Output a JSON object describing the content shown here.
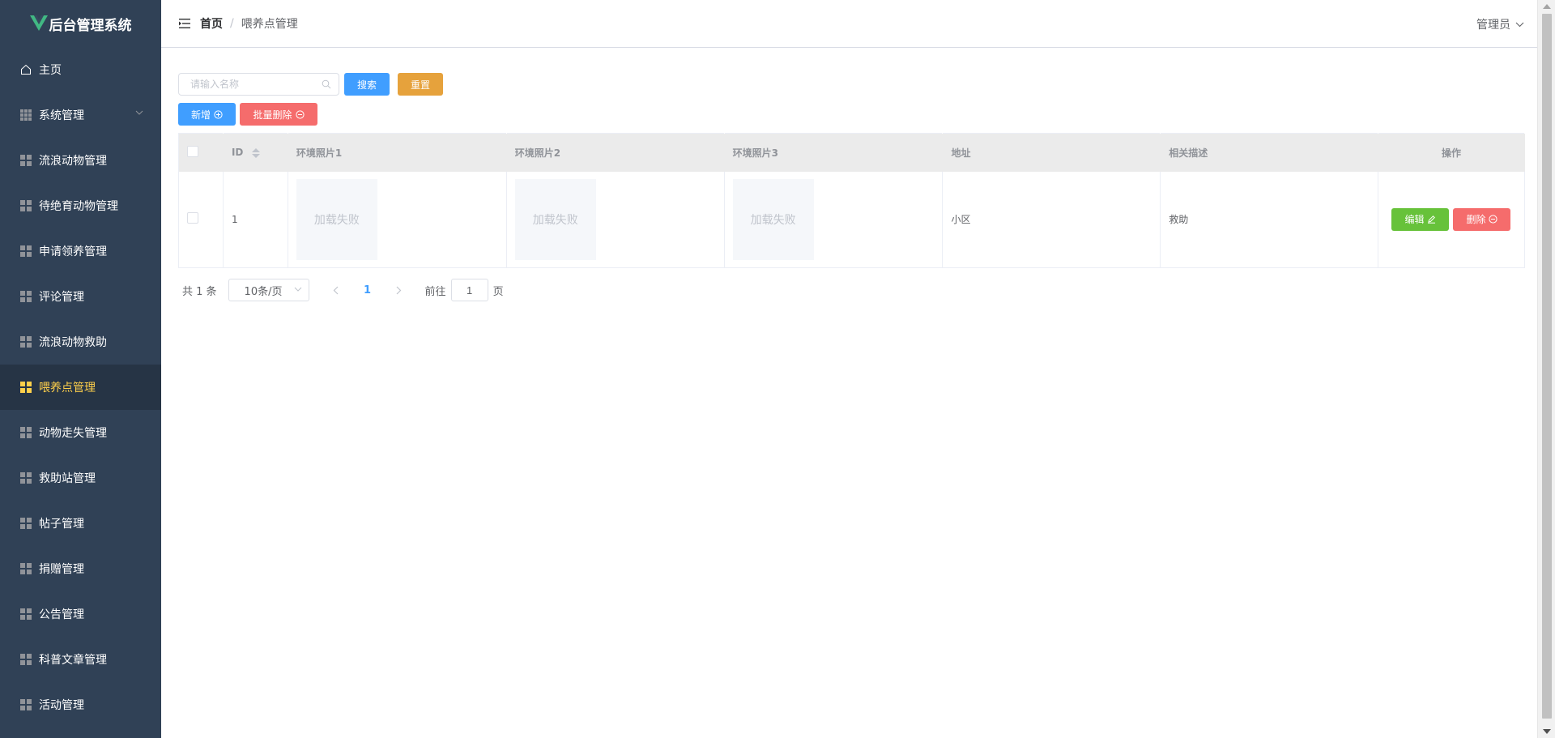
{
  "app": {
    "title": "后台管理系统",
    "logo_icon": "vue-logo-icon",
    "accent_color": "#409eff",
    "sidebar_bg": "#304156",
    "active_color": "#ffd04b"
  },
  "sidebar": {
    "items": [
      {
        "label": "主页",
        "icon": "home-icon"
      },
      {
        "label": "系统管理",
        "icon": "grid-icon",
        "expandable": true
      },
      {
        "label": "流浪动物管理",
        "icon": "grid-icon"
      },
      {
        "label": "待绝育动物管理",
        "icon": "grid-icon"
      },
      {
        "label": "申请领养管理",
        "icon": "grid-icon"
      },
      {
        "label": "评论管理",
        "icon": "grid-icon"
      },
      {
        "label": "流浪动物救助",
        "icon": "grid-icon"
      },
      {
        "label": "喂养点管理",
        "icon": "grid-icon",
        "active": true
      },
      {
        "label": "动物走失管理",
        "icon": "grid-icon"
      },
      {
        "label": "救助站管理",
        "icon": "grid-icon"
      },
      {
        "label": "帖子管理",
        "icon": "grid-icon"
      },
      {
        "label": "捐赠管理",
        "icon": "grid-icon"
      },
      {
        "label": "公告管理",
        "icon": "grid-icon"
      },
      {
        "label": "科普文章管理",
        "icon": "grid-icon"
      },
      {
        "label": "活动管理",
        "icon": "grid-icon"
      }
    ]
  },
  "header": {
    "breadcrumb_home": "首页",
    "breadcrumb_sep": "/",
    "breadcrumb_current": "喂养点管理",
    "user_label": "管理员"
  },
  "toolbar": {
    "search_placeholder": "请输入名称",
    "search_label": "搜索",
    "reset_label": "重置",
    "add_label": "新增",
    "batch_delete_label": "批量删除"
  },
  "table": {
    "columns": [
      "ID",
      "环境照片1",
      "环境照片2",
      "环境照片3",
      "地址",
      "相关描述",
      "操作"
    ],
    "rows": [
      {
        "id": "1",
        "photo1": "加载失败",
        "photo2": "加载失败",
        "photo3": "加载失败",
        "address": "小区",
        "description": "救助",
        "edit_label": "编辑",
        "delete_label": "删除"
      }
    ]
  },
  "pagination": {
    "total": "共 1 条",
    "page_size": "10条/页",
    "current_page": "1",
    "goto_label": "前往",
    "goto_value": "1",
    "page_suffix": "页"
  }
}
